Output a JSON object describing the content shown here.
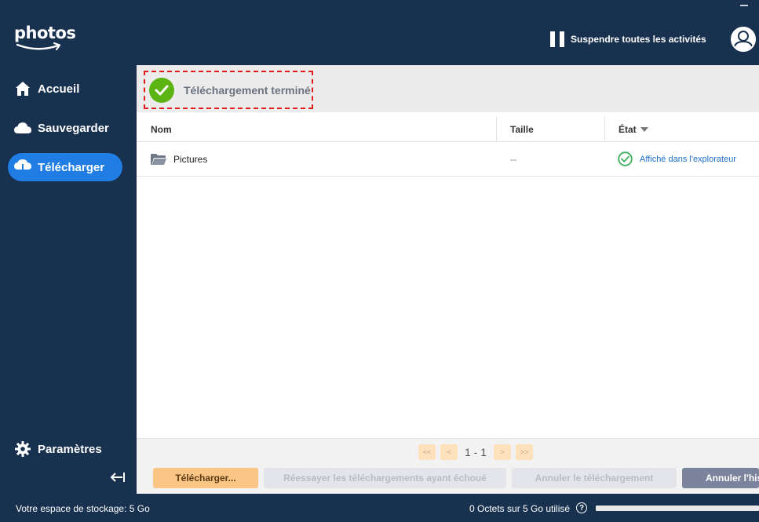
{
  "app": {
    "logo_text": "photos"
  },
  "header": {
    "pause_label": "Suspendre toutes les activités"
  },
  "sidebar": {
    "items": [
      {
        "label": "Accueil",
        "icon": "home-icon"
      },
      {
        "label": "Sauvegarder",
        "icon": "cloud-icon"
      },
      {
        "label": "Télécharger",
        "icon": "cloud-download-icon",
        "active": true
      }
    ],
    "settings_label": "Paramètres"
  },
  "banner": {
    "text": "Téléchargement terminé",
    "icon": "check-circle-icon",
    "color": "#5cb413"
  },
  "table": {
    "columns": [
      "Nom",
      "Taille",
      "État"
    ],
    "rows": [
      {
        "name": "Pictures",
        "size": "--",
        "status": "Affiché dans l'explorateur",
        "icon": "folder-icon"
      }
    ]
  },
  "pagination": {
    "first": "<<",
    "prev": "<",
    "range": "1 - 1",
    "next": ">",
    "last": ">>"
  },
  "actions": {
    "download": "Télécharger...",
    "retry": "Réessayer les téléchargements ayant échoué",
    "cancel": "Annuler le téléchargement",
    "history": "Annuler l'his"
  },
  "statusbar": {
    "storage_label": "Votre espace de stockage: 5 Go",
    "usage": "0 Octets sur 5 Go utilisé",
    "help": "?",
    "used_fraction": 0
  },
  "colors": {
    "navy": "#18314f",
    "accent": "#1f7de3",
    "success": "#5cb413"
  }
}
